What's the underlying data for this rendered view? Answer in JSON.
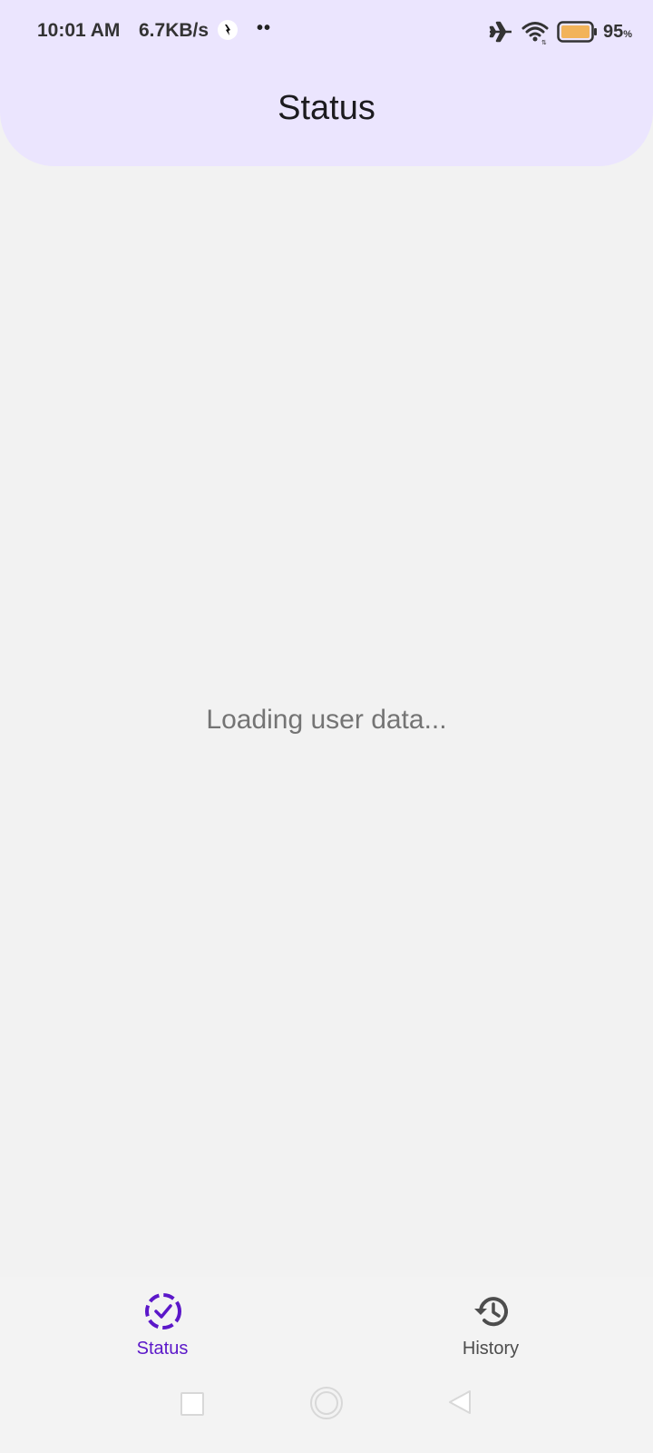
{
  "status_bar": {
    "time": "10:01 AM",
    "net_speed": "6.7KB/s",
    "dots": "••",
    "battery_pct": "95",
    "battery_unit": "%",
    "icons": [
      "notification-icon",
      "airplane-mode-icon",
      "wifi-icon",
      "battery-icon"
    ]
  },
  "header": {
    "title": "Status"
  },
  "main": {
    "loading_text": "Loading user data..."
  },
  "bottom_nav": {
    "items": [
      {
        "label": "Status",
        "icon": "status-check-icon",
        "active": true
      },
      {
        "label": "History",
        "icon": "history-icon",
        "active": false
      }
    ]
  },
  "colors": {
    "header_bg": "#ebe5fe",
    "accent": "#5b17c9",
    "battery_fill": "#f2b35a",
    "page_bg": "#f2f2f2"
  }
}
